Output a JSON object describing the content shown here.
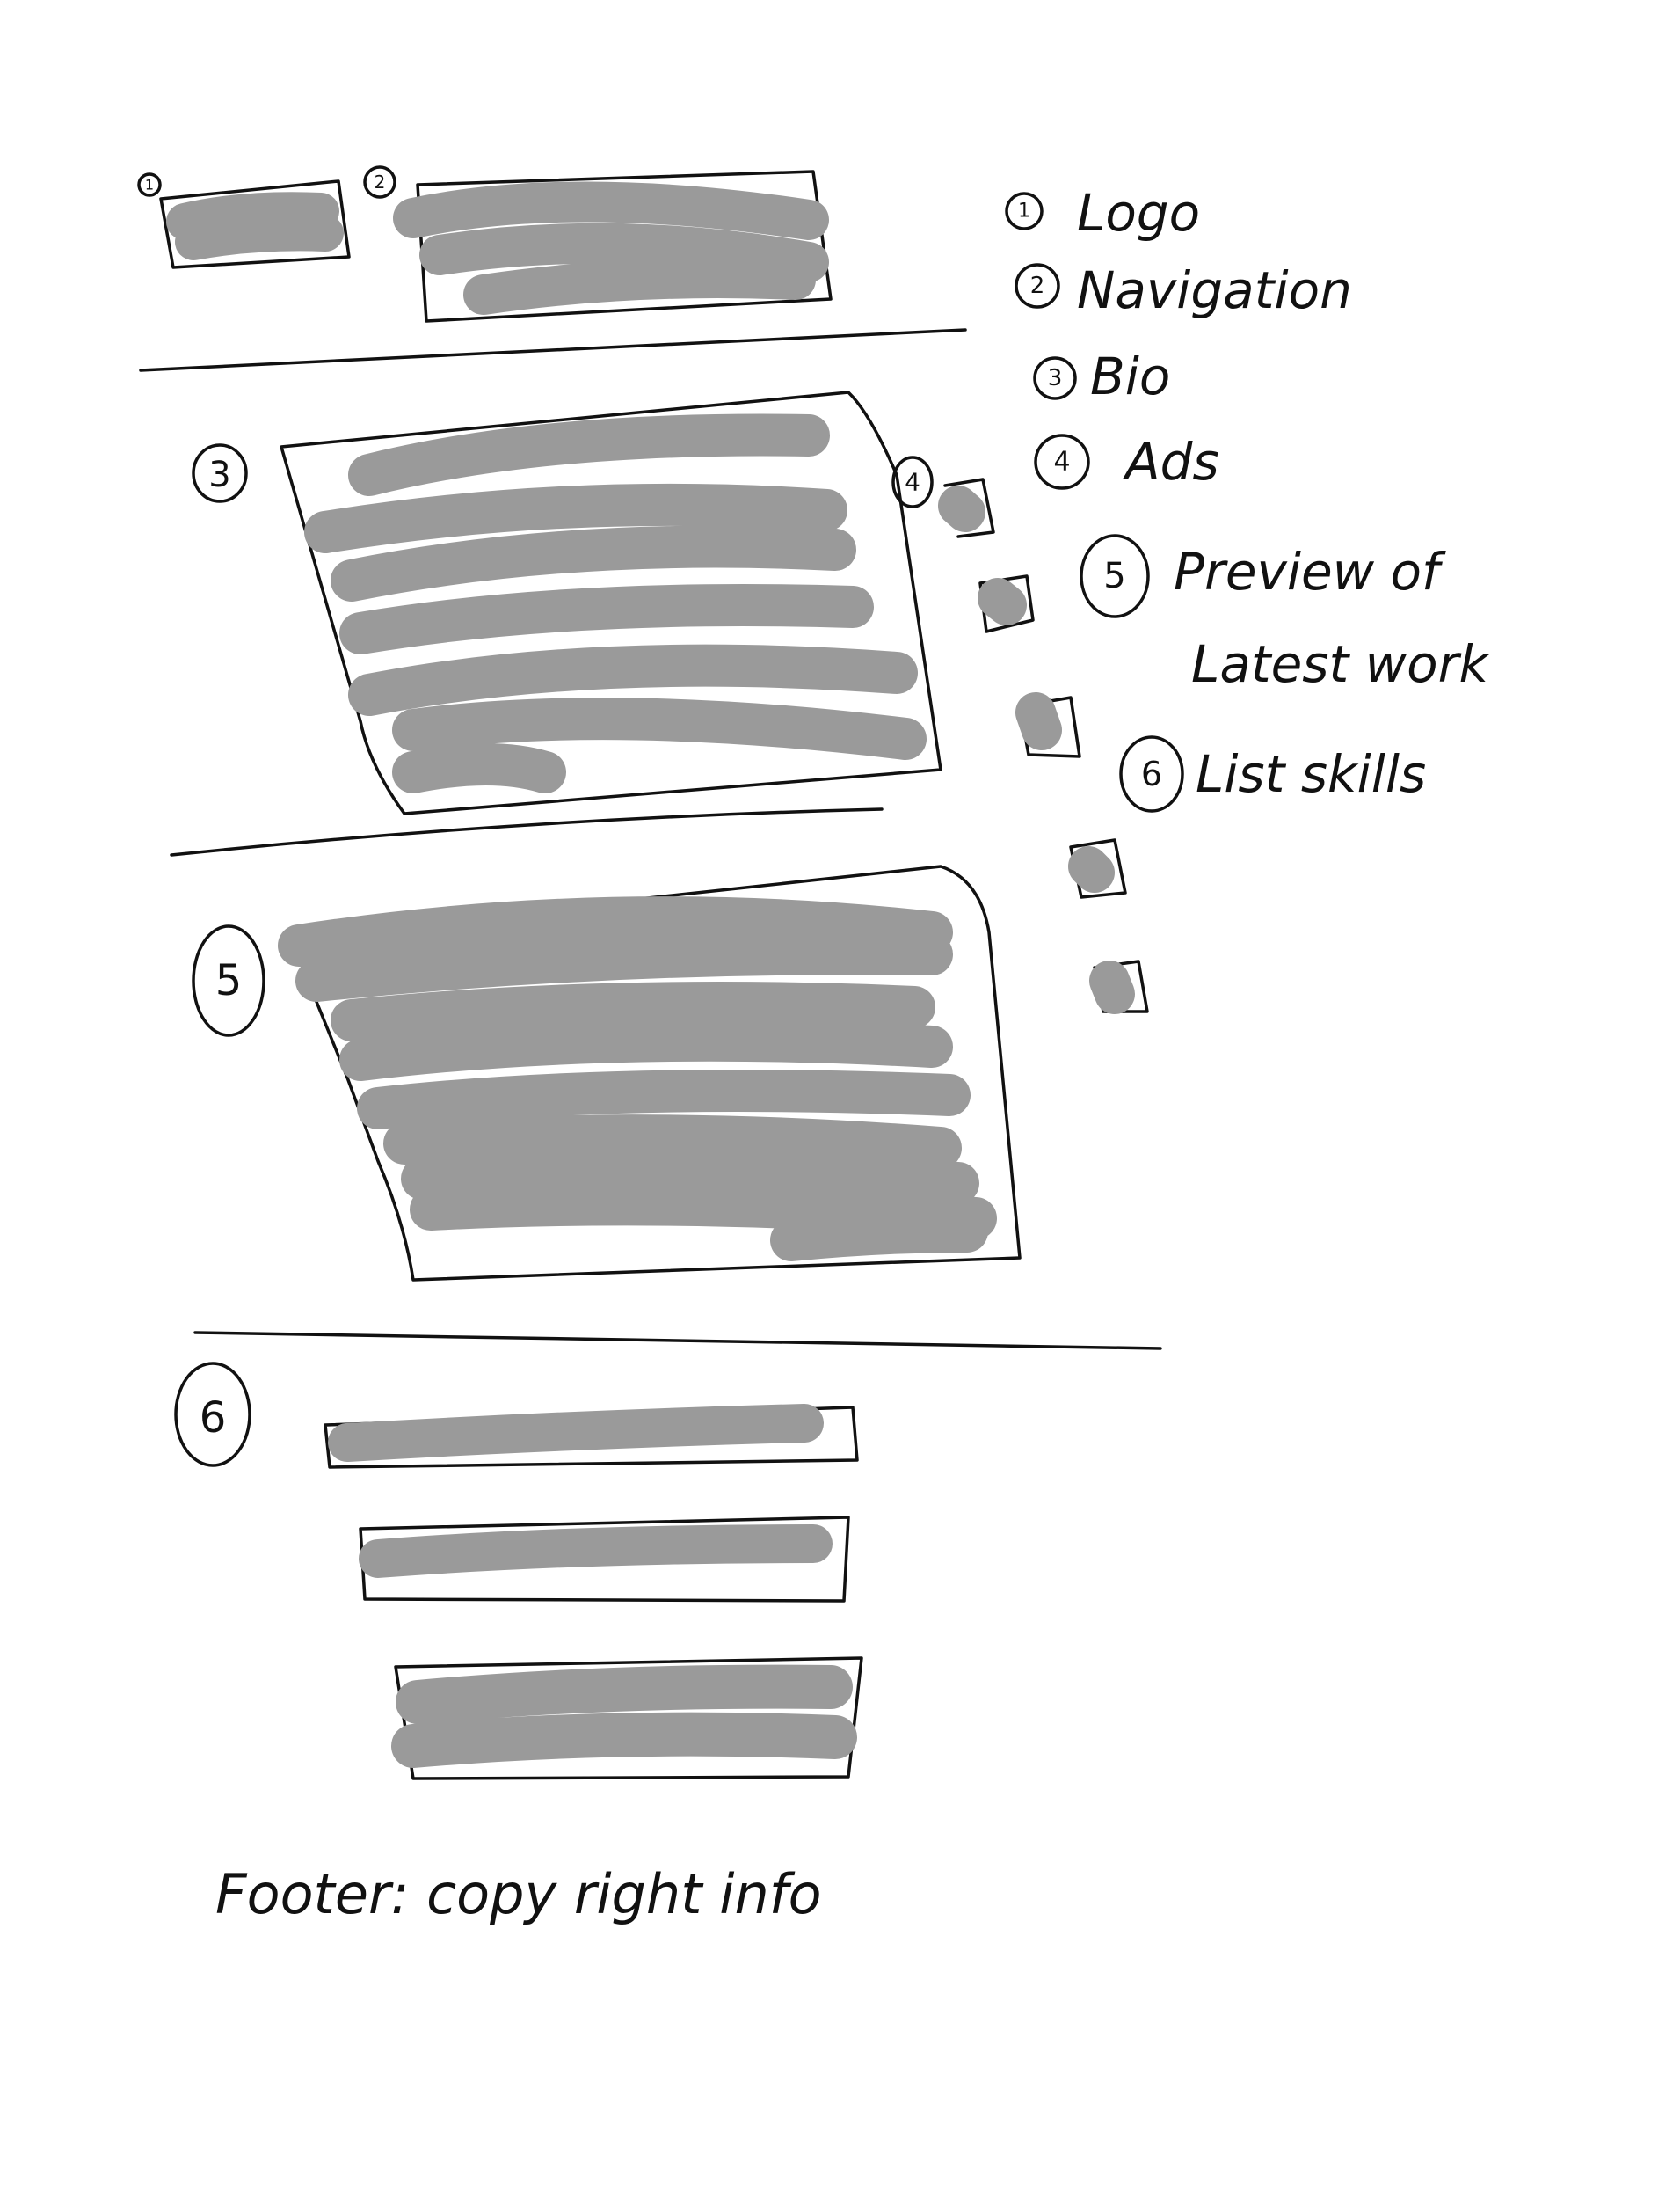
{
  "markers": [
    "1",
    "2",
    "3",
    "4",
    "5",
    "6"
  ],
  "legend": {
    "item1": "Logo",
    "item2": "Navigation",
    "item3": "Bio",
    "item4": "Ads",
    "item5_line1": "Preview of",
    "item5_line2": "Latest work",
    "item6": "List skills"
  },
  "footer": "Footer: copy right info",
  "colors": {
    "ink": "#111111",
    "scribble": "#9a9a9a",
    "paper": "#ffffff"
  }
}
